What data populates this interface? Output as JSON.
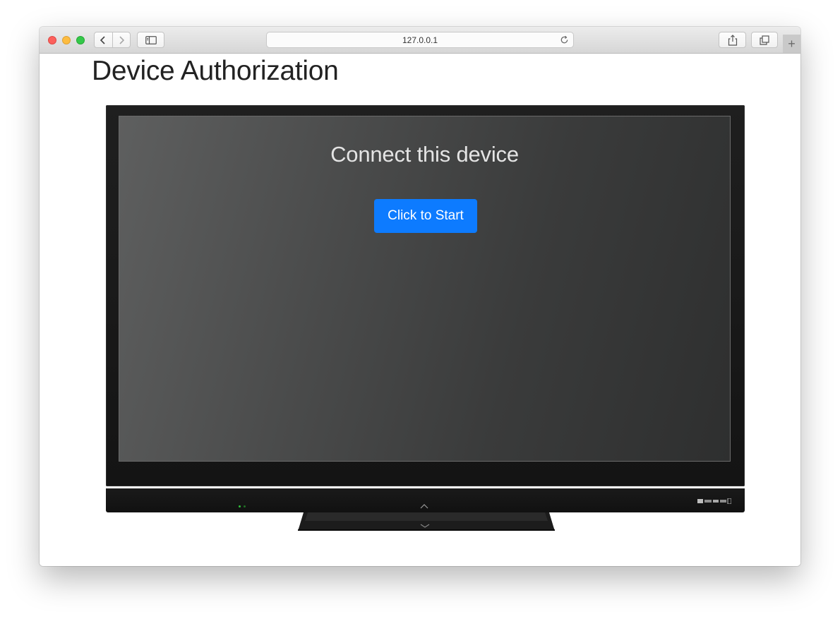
{
  "browser": {
    "url": "127.0.0.1",
    "new_tab_label": "+"
  },
  "page": {
    "title": "Device Authorization"
  },
  "device": {
    "heading": "Connect this device",
    "button_label": "Click to Start"
  },
  "colors": {
    "button": "#0d7bff",
    "screen": "#4a4b4b",
    "bezel": "#1a1a1a"
  },
  "icons": {
    "close": "close-icon",
    "minimize": "minimize-icon",
    "maximize": "maximize-icon",
    "back": "chevron-left-icon",
    "forward": "chevron-right-icon",
    "sidebar": "sidebar-icon",
    "reload": "reload-icon",
    "share": "share-icon",
    "tabs": "tabs-icon"
  }
}
